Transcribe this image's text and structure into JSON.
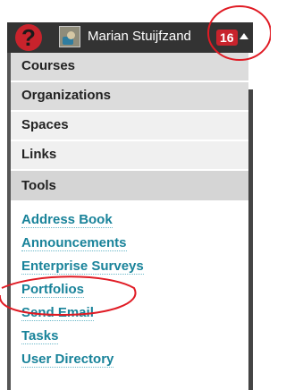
{
  "topbar": {
    "help_icon": "question-mark-icon",
    "help_glyph": "?",
    "user_name": "Marian Stuijfzand",
    "notification_count": "16",
    "caret_icon": "caret-up-icon"
  },
  "menu": {
    "items": [
      {
        "label": "Courses"
      },
      {
        "label": "Organizations"
      },
      {
        "label": "Spaces"
      },
      {
        "label": "Links"
      },
      {
        "label": "Tools"
      }
    ]
  },
  "tools": {
    "links": [
      {
        "label": "Address Book"
      },
      {
        "label": "Announcements"
      },
      {
        "label": "Enterprise Surveys"
      },
      {
        "label": "Portfolios"
      },
      {
        "label": "Send Email"
      },
      {
        "label": "Tasks"
      },
      {
        "label": "User Directory"
      }
    ]
  },
  "colors": {
    "topbar": "#333333",
    "badge": "#c8232c",
    "link": "#19839a",
    "annotation": "#e01b24"
  }
}
